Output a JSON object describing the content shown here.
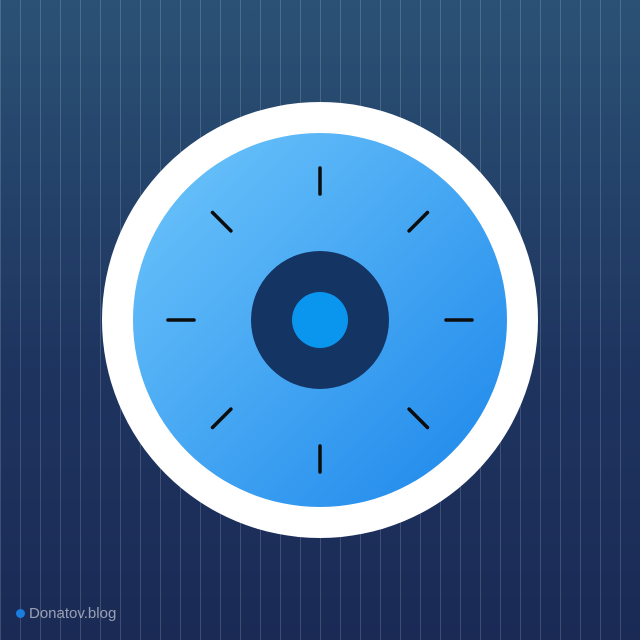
{
  "icon": {
    "name": "dial-icon",
    "colors": {
      "background_top": "#2b5275",
      "background_bottom": "#1a2a55",
      "ring": "#ffffff",
      "face_light": "#6fc6fb",
      "face_dark": "#1b86ea",
      "hub": "#143463",
      "center": "#0a96ee",
      "tick": "#0d0d0d"
    },
    "tick_count": 8
  },
  "watermark": {
    "text": "Donatov.blog",
    "dot_color": "#1a7ee0"
  }
}
